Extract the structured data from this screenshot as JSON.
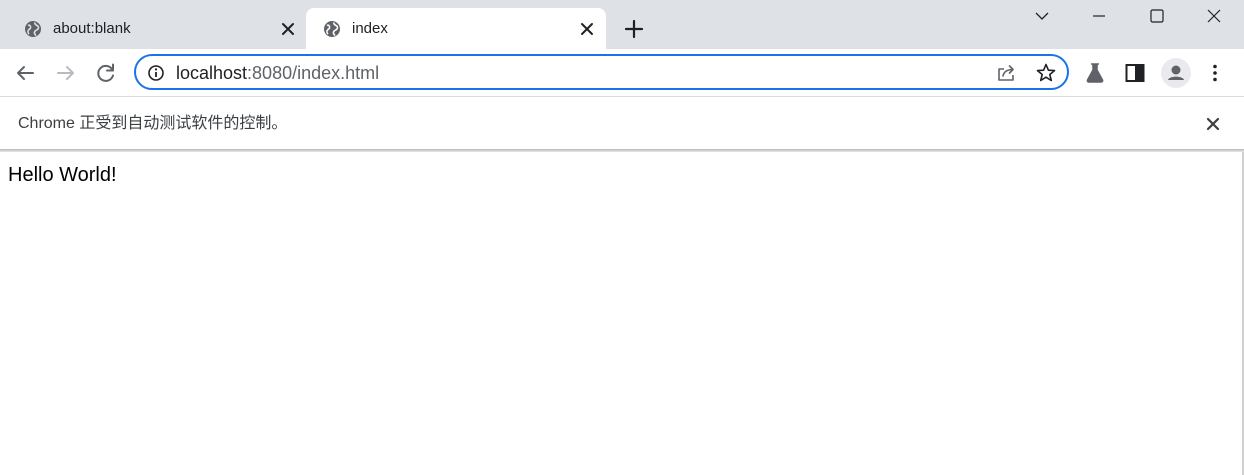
{
  "tabs": [
    {
      "title": "about:blank",
      "active": false,
      "icon": "globe-icon"
    },
    {
      "title": "index",
      "active": true,
      "icon": "globe-icon"
    }
  ],
  "omnibox": {
    "host": "localhost",
    "rest": ":8080/index.html"
  },
  "infobar": {
    "message": "Chrome 正受到自动测试软件的控制。"
  },
  "page": {
    "text": "Hello World!"
  },
  "colors": {
    "tabstrip": "#dee1e6",
    "focus_ring": "#1a73e8",
    "icon": "#5f6368"
  }
}
